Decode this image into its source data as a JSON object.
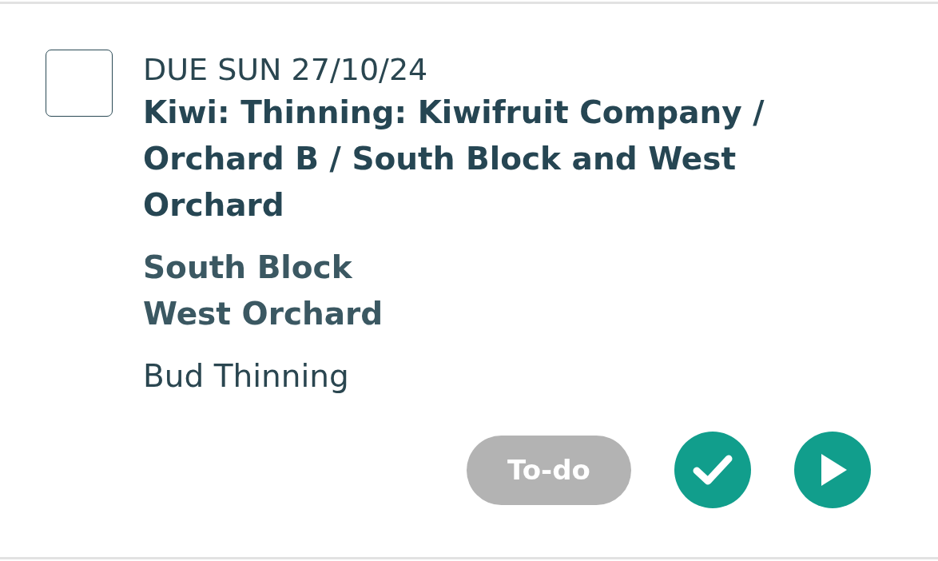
{
  "task": {
    "checked": false,
    "due": "DUE SUN 27/10/24",
    "title": "Kiwi: Thinning: Kiwifruit Company / Orchard B / South Block and West Orchard",
    "locations": [
      "South Block",
      "West Orchard"
    ],
    "activity": "Bud Thinning",
    "status": "To-do",
    "actions": [
      {
        "kind": "complete"
      },
      {
        "kind": "start"
      }
    ]
  }
}
